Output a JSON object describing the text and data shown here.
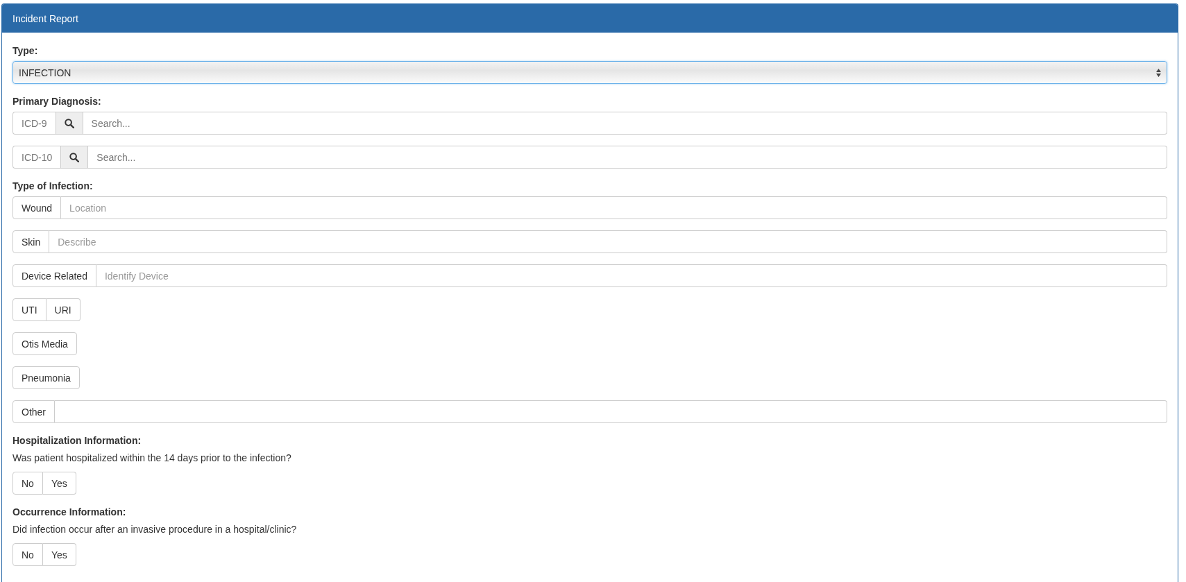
{
  "panel": {
    "title": "Incident Report"
  },
  "type_field": {
    "label": "Type:",
    "value": "INFECTION",
    "focused": true
  },
  "primary_diagnosis": {
    "label": "Primary Diagnosis:",
    "searches": [
      {
        "code": "ICD-9",
        "placeholder": "Search..."
      },
      {
        "code": "ICD-10",
        "placeholder": "Search..."
      }
    ]
  },
  "type_of_infection": {
    "label": "Type of Infection:",
    "rows": [
      {
        "kind": "input",
        "label": "Wound",
        "selected": false,
        "placeholder": "Location"
      },
      {
        "kind": "input",
        "label": "Skin",
        "selected": false,
        "placeholder": "Describe"
      },
      {
        "kind": "input",
        "label": "Device Related",
        "selected": false,
        "placeholder": "Identify Device"
      },
      {
        "kind": "toggles",
        "options": [
          {
            "label": "UTI",
            "selected": false
          },
          {
            "label": "URI",
            "selected": false
          }
        ]
      },
      {
        "kind": "toggles",
        "options": [
          {
            "label": "Otis Media",
            "selected": false
          }
        ]
      },
      {
        "kind": "toggles",
        "options": [
          {
            "label": "Pneumonia",
            "selected": false
          }
        ]
      },
      {
        "kind": "input",
        "label": "Other",
        "selected": false
      }
    ]
  },
  "sections": [
    {
      "heading": "Hospitalization Information:",
      "question": "Was patient hospitalized within the 14 days prior to the infection?",
      "options": [
        {
          "label": "No",
          "selected": false
        },
        {
          "label": "Yes",
          "selected": false
        }
      ]
    },
    {
      "heading": "Occurrence Information:",
      "question": "Did infection occur after an invasive procedure in a hospital/clinic?",
      "options": [
        {
          "label": "No",
          "selected": false
        },
        {
          "label": "Yes",
          "selected": false
        }
      ]
    }
  ]
}
